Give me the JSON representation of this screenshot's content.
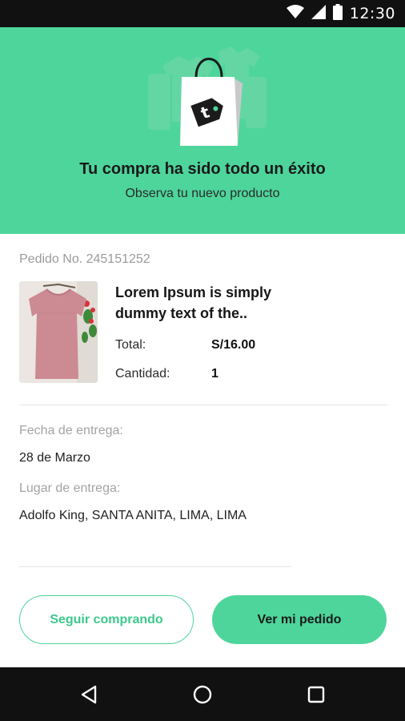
{
  "status_bar": {
    "time": "12:30",
    "icons": [
      "wifi-icon",
      "signal-icon",
      "battery-icon"
    ]
  },
  "hero": {
    "title": "Tu compra ha sido todo un éxito",
    "subtitle": "Observa tu nuevo producto",
    "background_color": "#4ed59b",
    "illustration": "shopping-bag-icon"
  },
  "order": {
    "number_text": "Pedido No. 245151252",
    "product": {
      "name": "Lorem Ipsum is simply dummy text of the..",
      "image": "pink-shirt-photo"
    },
    "total_label": "Total:",
    "total_value": "S/16.00",
    "quantity_label": "Cantidad:",
    "quantity_value": "1"
  },
  "delivery": {
    "date_label": "Fecha de entrega:",
    "date_value": "28 de Marzo",
    "place_label": "Lugar de entrega:",
    "place_value": "Adolfo King, SANTA ANITA, LIMA, LIMA"
  },
  "actions": {
    "continue_label": "Seguir comprando",
    "view_order_label": "Ver mi pedido",
    "accent_color": "#4ed59b"
  },
  "nav_bar": {
    "icons": [
      "back-icon",
      "home-icon",
      "recents-icon"
    ]
  }
}
